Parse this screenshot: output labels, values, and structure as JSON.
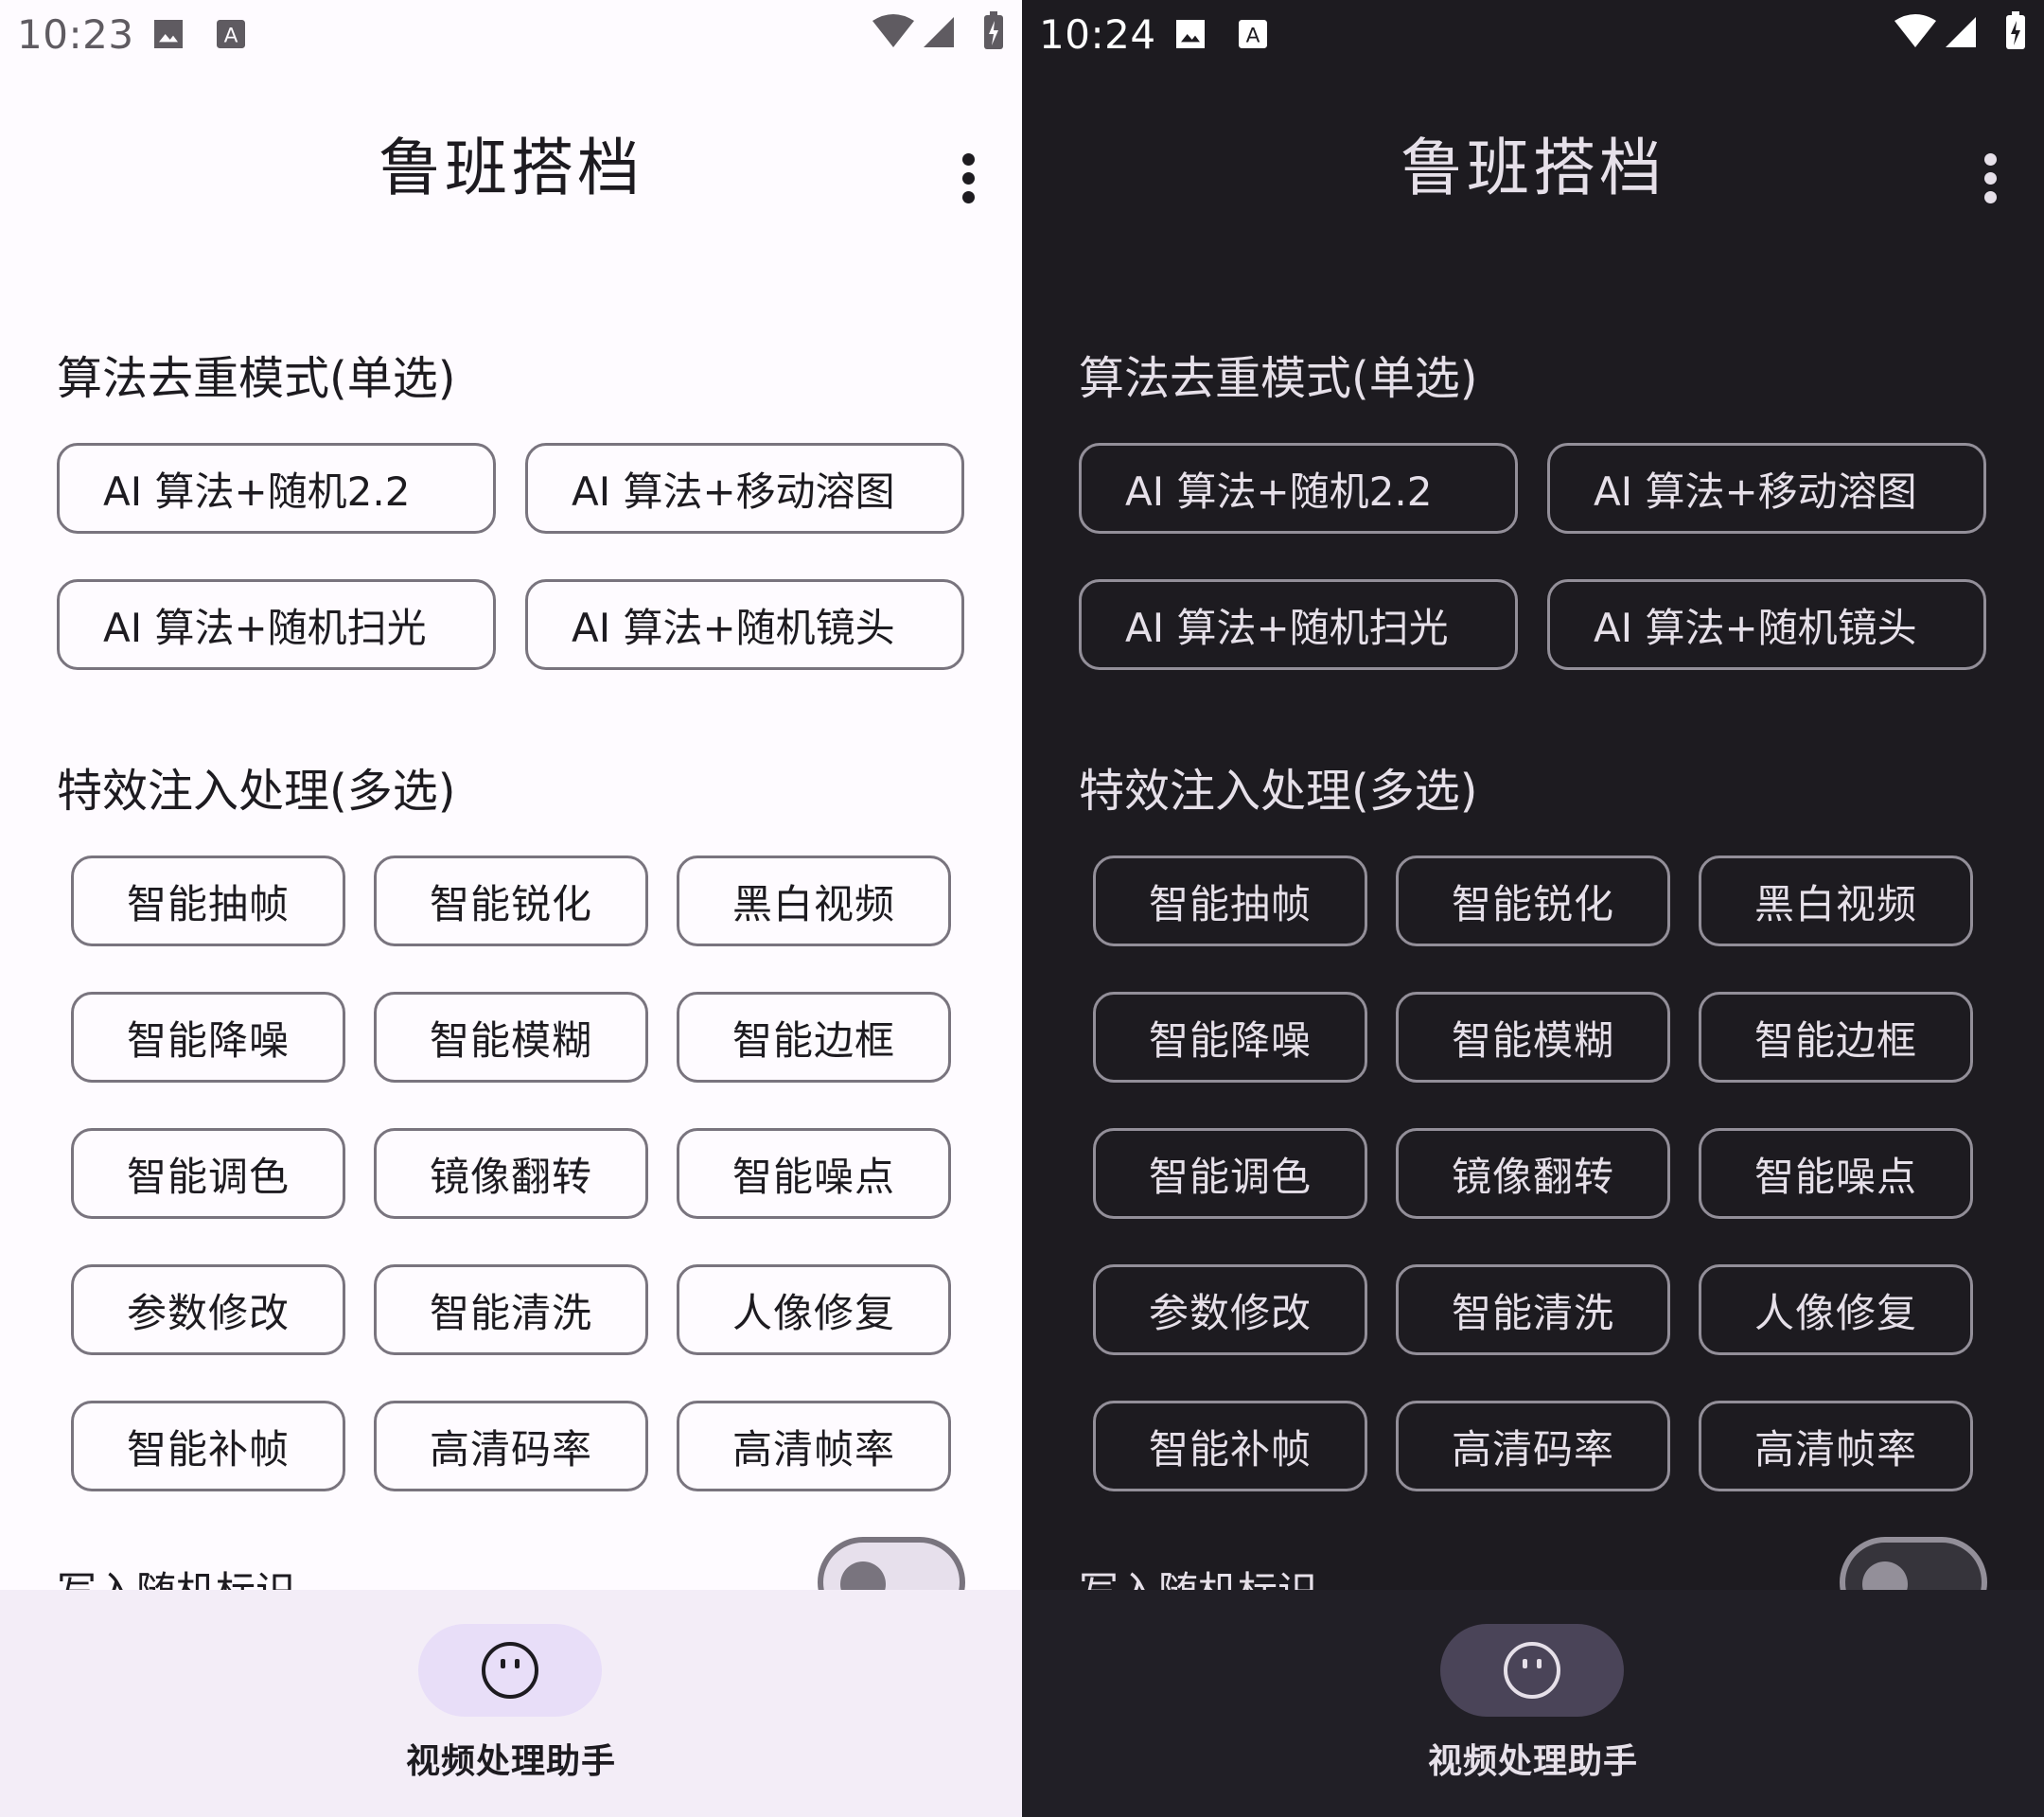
{
  "screens": [
    {
      "theme": "light",
      "status": {
        "time": "10:23"
      },
      "app_title": "鲁班搭档",
      "section1_title": "算法去重模式(单选)",
      "algo_options": [
        "AI 算法+随机2.2",
        "AI 算法+移动溶图",
        "AI 算法+随机扫光",
        "AI 算法+随机镜头"
      ],
      "section2_title": "特效注入处理(多选)",
      "effects": [
        "智能抽帧",
        "智能锐化",
        "黑白视频",
        "智能降噪",
        "智能模糊",
        "智能边框",
        "智能调色",
        "镜像翻转",
        "智能噪点",
        "参数修改",
        "智能清洗",
        "人像修复",
        "智能补帧",
        "高清码率",
        "高清帧率"
      ],
      "toggle_label": "写入随机标识",
      "toggle_on": false,
      "nav": {
        "label": "视频处理助手",
        "icon": "face-icon"
      }
    },
    {
      "theme": "dark",
      "status": {
        "time": "10:24"
      },
      "app_title": "鲁班搭档",
      "section1_title": "算法去重模式(单选)",
      "algo_options": [
        "AI 算法+随机2.2",
        "AI 算法+移动溶图",
        "AI 算法+随机扫光",
        "AI 算法+随机镜头"
      ],
      "section2_title": "特效注入处理(多选)",
      "effects": [
        "智能抽帧",
        "智能锐化",
        "黑白视频",
        "智能降噪",
        "智能模糊",
        "智能边框",
        "智能调色",
        "镜像翻转",
        "智能噪点",
        "参数修改",
        "智能清洗",
        "人像修复",
        "智能补帧",
        "高清码率",
        "高清帧率"
      ],
      "toggle_label": "写入随机标识",
      "toggle_on": false,
      "nav": {
        "label": "视频处理助手",
        "icon": "face-icon"
      }
    }
  ],
  "colors": {
    "light_background": "#fefbff",
    "dark_background": "#1d1b20",
    "light_nav_pill": "#e8def8",
    "dark_nav_pill": "#4a4458"
  }
}
